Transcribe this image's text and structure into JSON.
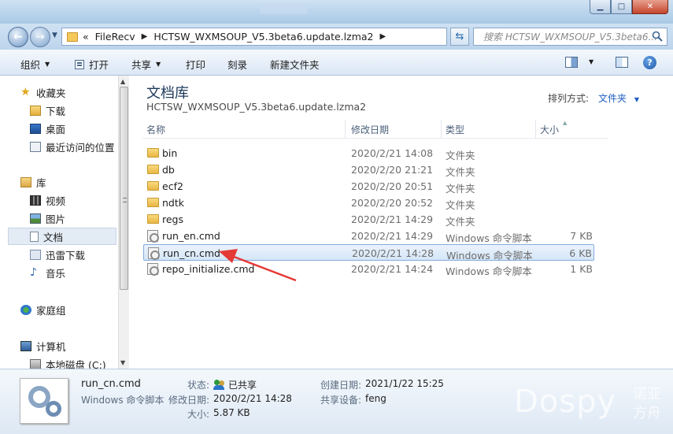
{
  "window": {
    "minimize": "▁",
    "maximize": "□",
    "close": "✕"
  },
  "nav": {
    "address_parts": [
      "«",
      "FileRecv",
      "HCTSW_WXMSOUP_V5.3beta6.update.lzma2"
    ],
    "search_placeholder": "搜索 HCTSW_WXMSOUP_V5.3beta6..."
  },
  "toolbar": {
    "organize": "组织",
    "open": "打开",
    "share": "共享",
    "print": "打印",
    "burn": "刻录",
    "new_folder": "新建文件夹"
  },
  "sidebar": {
    "items": [
      {
        "label": "收藏夹",
        "icon": "star-icon"
      },
      {
        "label": "下载",
        "icon": "download-folder-icon"
      },
      {
        "label": "桌面",
        "icon": "desktop-icon"
      },
      {
        "label": "最近访问的位置",
        "icon": "recent-places-icon"
      },
      {
        "label": "库",
        "icon": "library-icon"
      },
      {
        "label": "视频",
        "icon": "video-icon"
      },
      {
        "label": "图片",
        "icon": "picture-icon"
      },
      {
        "label": "文档",
        "icon": "document-icon"
      },
      {
        "label": "迅雷下载",
        "icon": "thunder-download-icon"
      },
      {
        "label": "音乐",
        "icon": "music-icon"
      },
      {
        "label": "家庭组",
        "icon": "homegroup-icon"
      },
      {
        "label": "计算机",
        "icon": "computer-icon"
      },
      {
        "label": "本地磁盘 (C:)",
        "icon": "local-disk-icon"
      }
    ]
  },
  "library": {
    "title": "文档库",
    "subtitle": "HCTSW_WXMSOUP_V5.3beta6.update.lzma2",
    "arrange_label": "排列方式:",
    "arrange_value": "文件夹"
  },
  "columns": {
    "name": "名称",
    "date": "修改日期",
    "type": "类型",
    "size": "大小"
  },
  "files": [
    {
      "name": "bin",
      "date": "2020/2/21 14:08",
      "type": "文件夹",
      "size": "",
      "kind": "folder"
    },
    {
      "name": "db",
      "date": "2020/2/20 21:21",
      "type": "文件夹",
      "size": "",
      "kind": "folder"
    },
    {
      "name": "ecf2",
      "date": "2020/2/20 20:51",
      "type": "文件夹",
      "size": "",
      "kind": "folder"
    },
    {
      "name": "ndtk",
      "date": "2020/2/20 20:52",
      "type": "文件夹",
      "size": "",
      "kind": "folder"
    },
    {
      "name": "regs",
      "date": "2020/2/21 14:29",
      "type": "文件夹",
      "size": "",
      "kind": "folder"
    },
    {
      "name": "run_en.cmd",
      "date": "2020/2/21 14:29",
      "type": "Windows 命令脚本",
      "size": "7 KB",
      "kind": "cmd"
    },
    {
      "name": "run_cn.cmd",
      "date": "2020/2/21 14:28",
      "type": "Windows 命令脚本",
      "size": "6 KB",
      "kind": "cmd",
      "selected": true
    },
    {
      "name": "repo_initialize.cmd",
      "date": "2020/2/21 14:24",
      "type": "Windows 命令脚本",
      "size": "1 KB",
      "kind": "cmd"
    }
  ],
  "details": {
    "filename": "run_cn.cmd",
    "filetype": "Windows 命令脚本",
    "state_label": "状态:",
    "state_value": "已共享",
    "modified_label": "修改日期:",
    "modified_value": "2020/2/21 14:28",
    "size_label": "大小:",
    "size_value": "5.87 KB",
    "created_label": "创建日期:",
    "created_value": "2021/1/22 15:25",
    "shared_label": "共享设备:",
    "shared_value": "feng"
  },
  "watermark": {
    "latin": "Dospy",
    "cn": "诺亚方舟"
  },
  "colors": {
    "accent": "#1e5ec4",
    "selection_border": "#84acdd",
    "annotation": "#e53935"
  }
}
